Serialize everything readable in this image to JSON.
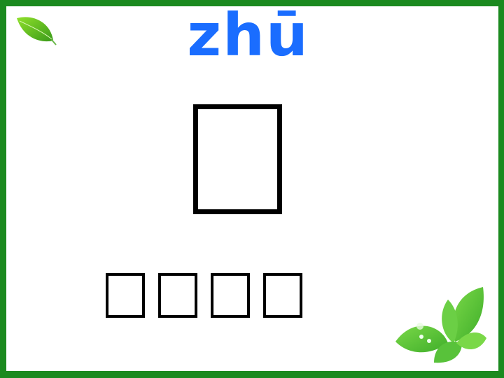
{
  "slide": {
    "pinyin": "zhū",
    "colors": {
      "border": "#1b8a1f",
      "pinyin": "#1a6dff",
      "leaf": "#5cc83a"
    },
    "main_character_glyph": "missing-glyph-box",
    "word_glyph_count": 4
  }
}
